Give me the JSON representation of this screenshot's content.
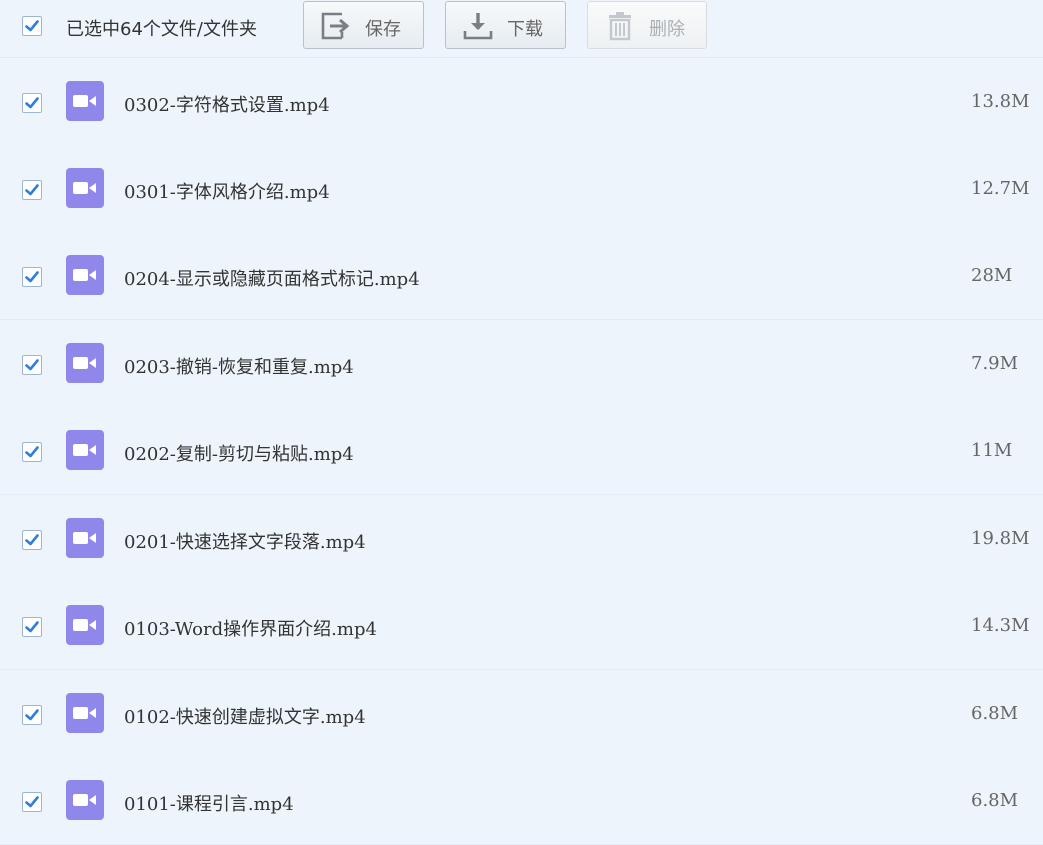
{
  "toolbar": {
    "select_all_checked": true,
    "selection_text": "已选中64个文件/文件夹",
    "save_label": "保存",
    "download_label": "下载",
    "delete_label": "删除",
    "save_icon": "save-to-icon",
    "download_icon": "download-icon",
    "delete_icon": "trash-icon"
  },
  "colors": {
    "checkbox_check": "#2f7fd8",
    "file_icon_bg": "#8f87ea",
    "background": "#eef4fb"
  },
  "files": [
    {
      "name": "0302-字符格式设置.mp4",
      "size": "13.8M",
      "checked": true,
      "icon": "video-file-icon"
    },
    {
      "name": "0301-字体风格介绍.mp4",
      "size": "12.7M",
      "checked": true,
      "icon": "video-file-icon"
    },
    {
      "name": "0204-显示或隐藏页面格式标记.mp4",
      "size": "28M",
      "checked": true,
      "icon": "video-file-icon"
    },
    {
      "name": "0203-撤销-恢复和重复.mp4",
      "size": "7.9M",
      "checked": true,
      "icon": "video-file-icon"
    },
    {
      "name": "0202-复制-剪切与粘贴.mp4",
      "size": "11M",
      "checked": true,
      "icon": "video-file-icon"
    },
    {
      "name": "0201-快速选择文字段落.mp4",
      "size": "19.8M",
      "checked": true,
      "icon": "video-file-icon"
    },
    {
      "name": "0103-Word操作界面介绍.mp4",
      "size": "14.3M",
      "checked": true,
      "icon": "video-file-icon"
    },
    {
      "name": "0102-快速创建虚拟文字.mp4",
      "size": "6.8M",
      "checked": true,
      "icon": "video-file-icon"
    },
    {
      "name": "0101-课程引言.mp4",
      "size": "6.8M",
      "checked": true,
      "icon": "video-file-icon"
    }
  ]
}
